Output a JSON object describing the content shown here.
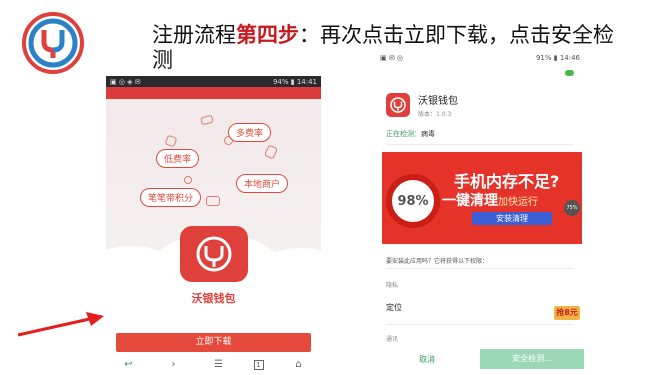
{
  "title": {
    "prefix": "注册流程",
    "highlight": "第四步",
    "rest": "：再次点击立即下载，点击安全检测"
  },
  "colors": {
    "brand_red": "#e0403c",
    "highlight_red": "#c8191f",
    "green": "#3a9a5c"
  },
  "left_phone": {
    "status_left": "▣ ◎ ◈ ✉",
    "status_right": "94% ▮ 14:41",
    "tags": [
      "多费率",
      "低费率",
      "本地商户",
      "笔笔带积分"
    ],
    "app_name": "沃银钱包",
    "download_button": "立即下载",
    "nav_icons": [
      "back-icon",
      "forward-icon",
      "menu-icon",
      "tabs-icon",
      "home-icon"
    ],
    "nav_glyphs": [
      "↩",
      "›",
      "☰",
      "1",
      "⌂"
    ]
  },
  "right_phone": {
    "status_left": "▣ ✉ ◎",
    "status_right": "91% ▮ 14:46",
    "app_title": "沃银钱包",
    "version": "版本：1.0.3",
    "checking_label": "正在检测：",
    "checking_value": "病毒",
    "ad": {
      "gauge": "98%",
      "line1": "手机内存不足?",
      "line2_main": "一键清理",
      "line2_sub": "加快运行",
      "button": "安装清理",
      "corner": "75%"
    },
    "permission_question": "要安装此应用吗？它将获得以下权限：",
    "section_privacy": "隐私",
    "perm_location": "定位",
    "section_comm": "通讯",
    "coupon": "抢8元",
    "cancel": "取消",
    "scan": "安全检测..."
  }
}
